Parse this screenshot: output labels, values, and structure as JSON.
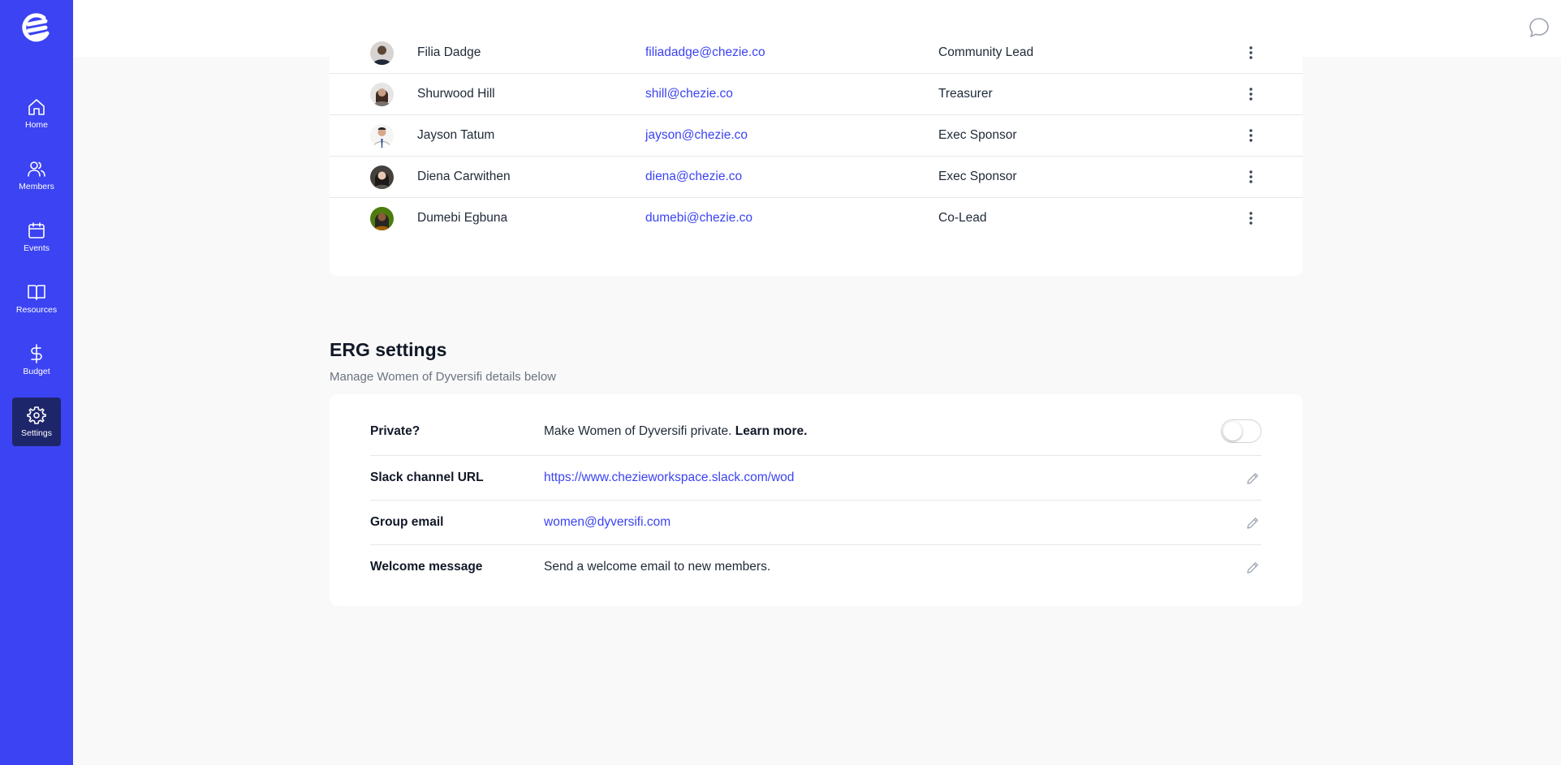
{
  "nav": {
    "logo": "chezie-logo",
    "items": [
      {
        "label": "Home",
        "icon": "home-icon"
      },
      {
        "label": "Members",
        "icon": "members-icon"
      },
      {
        "label": "Events",
        "icon": "calendar-icon"
      },
      {
        "label": "Resources",
        "icon": "book-icon"
      },
      {
        "label": "Budget",
        "icon": "dollar-icon"
      },
      {
        "label": "Settings",
        "icon": "gear-icon",
        "active": true
      }
    ]
  },
  "topbar": {
    "chat_icon": "chat-bubble-icon",
    "avatar_icon": "chezie-logo",
    "menu_icon": "caret-down-icon"
  },
  "members": [
    {
      "name": "Filia Dadge",
      "email": "filiadadge@chezie.co",
      "role": "Community Lead"
    },
    {
      "name": "Shurwood Hill",
      "email": "shill@chezie.co",
      "role": "Treasurer"
    },
    {
      "name": "Jayson Tatum",
      "email": "jayson@chezie.co",
      "role": "Exec Sponsor"
    },
    {
      "name": "Diena Carwithen",
      "email": "diena@chezie.co",
      "role": "Exec Sponsor"
    },
    {
      "name": "Dumebi Egbuna",
      "email": "dumebi@chezie.co",
      "role": "Co-Lead"
    }
  ],
  "erg_settings": {
    "title": "ERG settings",
    "subtitle": "Manage Women of Dyversifi details below",
    "private": {
      "label": "Private?",
      "text": "Make Women of Dyversifi private.",
      "link": "Learn more.",
      "enabled": false
    },
    "slack": {
      "label": "Slack channel URL",
      "value": "https://www.chezieworkspace.slack.com/wod"
    },
    "group_email": {
      "label": "Group email",
      "value": "women@dyversifi.com"
    },
    "welcome": {
      "label": "Welcome message",
      "value": "Send a welcome email to new members."
    }
  },
  "colors": {
    "brand": "#3b43f2",
    "nav_active": "#1e266b",
    "link": "#3b43f2"
  }
}
